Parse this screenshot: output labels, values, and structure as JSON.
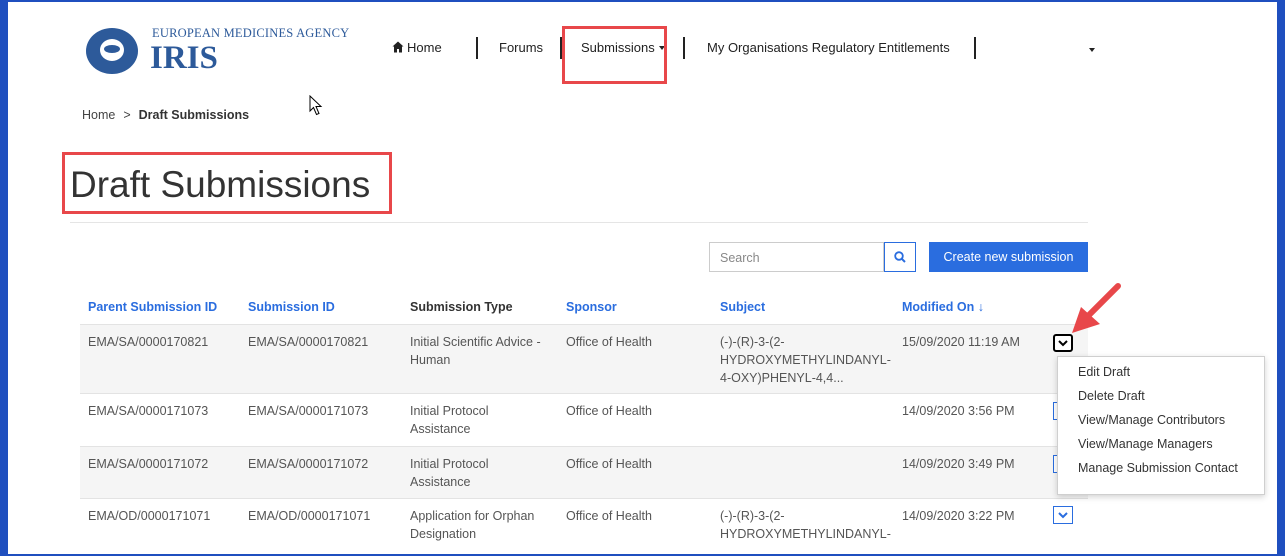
{
  "header": {
    "agency": "EUROPEAN MEDICINES AGENCY",
    "app_name": "IRIS",
    "nav": {
      "home": "Home",
      "forums": "Forums",
      "submissions": "Submissions",
      "entitlements": "My Organisations Regulatory Entitlements"
    }
  },
  "breadcrumb": {
    "home": "Home",
    "separator": ">",
    "current": "Draft Submissions"
  },
  "page_title": "Draft Submissions",
  "toolbar": {
    "search_placeholder": "Search",
    "create_label": "Create new submission"
  },
  "table": {
    "columns": [
      "Parent Submission ID",
      "Submission ID",
      "Submission Type",
      "Sponsor",
      "Subject",
      "Modified On"
    ],
    "sort_indicator": "↓",
    "rows": [
      {
        "parent_id": "EMA/SA/0000170821",
        "submission_id": "EMA/SA/0000170821",
        "type_l1": "Initial Scientific Advice -",
        "type_l2": "Human",
        "sponsor": "Office of Health",
        "subject_l1": "(-)-(R)-3-(2-",
        "subject_l2": "HYDROXYMETHYLINDANYL-",
        "subject_l3": "4-OXY)PHENYL-4,4...",
        "modified": "15/09/2020 11:19 AM"
      },
      {
        "parent_id": "EMA/SA/0000171073",
        "submission_id": "EMA/SA/0000171073",
        "type_l1": "Initial Protocol",
        "type_l2": "Assistance",
        "sponsor": "Office of Health",
        "subject_l1": "",
        "subject_l2": "",
        "subject_l3": "",
        "modified": "14/09/2020 3:56 PM"
      },
      {
        "parent_id": "EMA/SA/0000171072",
        "submission_id": "EMA/SA/0000171072",
        "type_l1": "Initial Protocol",
        "type_l2": "Assistance",
        "sponsor": "Office of Health",
        "subject_l1": "",
        "subject_l2": "",
        "subject_l3": "",
        "modified": "14/09/2020 3:49 PM"
      },
      {
        "parent_id": "EMA/OD/0000171071",
        "submission_id": "EMA/OD/0000171071",
        "type_l1": "Application for Orphan",
        "type_l2": "Designation",
        "sponsor": "Office of Health",
        "subject_l1": "(-)-(R)-3-(2-",
        "subject_l2": "HYDROXYMETHYLINDANYL-",
        "subject_l3": "",
        "modified": "14/09/2020 3:22 PM"
      }
    ]
  },
  "row_menu": [
    "Edit Draft",
    "Delete Draft",
    "View/Manage Contributors",
    "View/Manage Managers",
    "Manage Submission Contact"
  ],
  "colors": {
    "accent": "#2a6ddf",
    "highlight": "#e8474a",
    "frame": "#1f4fbf",
    "logo": "#2d5a9a"
  },
  "icons": [
    "home-icon",
    "caret-down-icon",
    "search-icon",
    "chevron-down-icon",
    "cursor-icon",
    "arrow-annotation-icon"
  ]
}
